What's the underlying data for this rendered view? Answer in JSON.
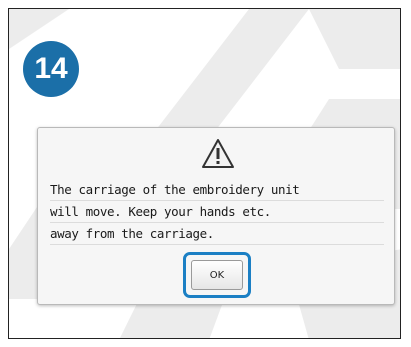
{
  "step": {
    "number": "14"
  },
  "dialog": {
    "icon": "warning-triangle-icon",
    "message_lines": [
      "The carriage of the embroidery unit",
      "will move. Keep your hands etc.",
      "away from the carriage."
    ],
    "ok_label": "OK"
  },
  "colors": {
    "badge": "#1b6fa8",
    "highlight_ring": "#1b7fc4",
    "watermark": "#e9e9e9"
  }
}
